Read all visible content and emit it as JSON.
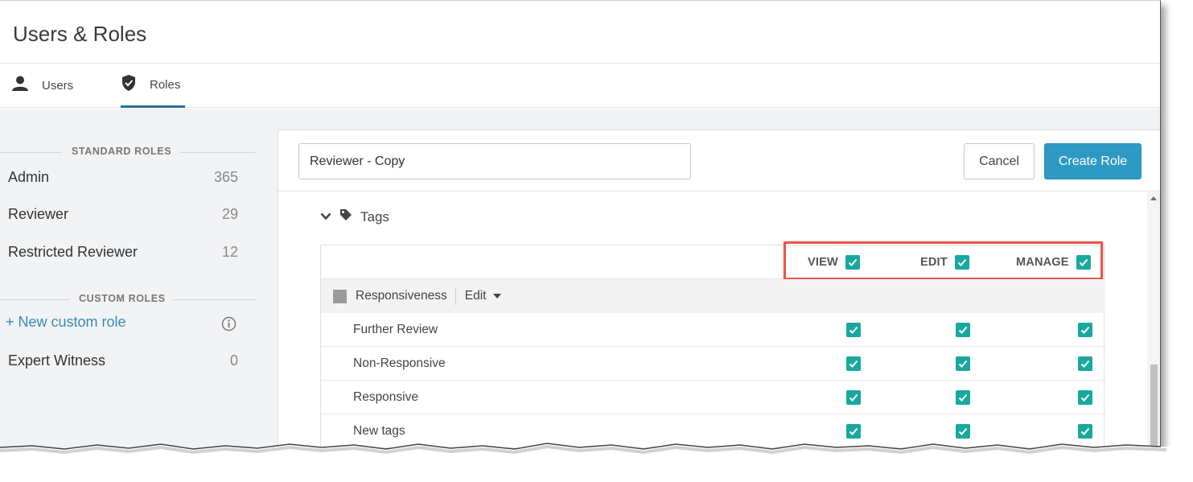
{
  "header": {
    "title": "Users & Roles"
  },
  "tabs": [
    {
      "label": "Users",
      "icon": "person-icon"
    },
    {
      "label": "Roles",
      "icon": "shield-check-icon",
      "active": true
    }
  ],
  "sidebar": {
    "standard_heading": "STANDARD ROLES",
    "standard_roles": [
      {
        "name": "Admin",
        "count": "365"
      },
      {
        "name": "Reviewer",
        "count": "29"
      },
      {
        "name": "Restricted Reviewer",
        "count": "12"
      }
    ],
    "custom_heading": "CUSTOM ROLES",
    "new_custom_role": "+ New custom role",
    "custom_roles": [
      {
        "name": "Expert Witness",
        "count": "0"
      }
    ]
  },
  "editor": {
    "role_name_value": "Reviewer - Copy",
    "cancel_label": "Cancel",
    "create_label": "Create Role",
    "section_label": "Tags",
    "columns": {
      "view": "VIEW",
      "edit": "EDIT",
      "manage": "MANAGE"
    },
    "group": {
      "name": "Responsiveness",
      "edit_label": "Edit"
    },
    "tags": [
      {
        "name": "Further Review",
        "view": true,
        "edit": true,
        "manage": true
      },
      {
        "name": "Non-Responsive",
        "view": true,
        "edit": true,
        "manage": true
      },
      {
        "name": "Responsive",
        "view": true,
        "edit": true,
        "manage": true
      },
      {
        "name": "New tags",
        "view": true,
        "edit": true,
        "manage": true
      }
    ]
  },
  "colors": {
    "accent": "#2e9ac4",
    "checkbox": "#18a89e",
    "highlight": "#e8574c",
    "link": "#3a8ab9"
  }
}
